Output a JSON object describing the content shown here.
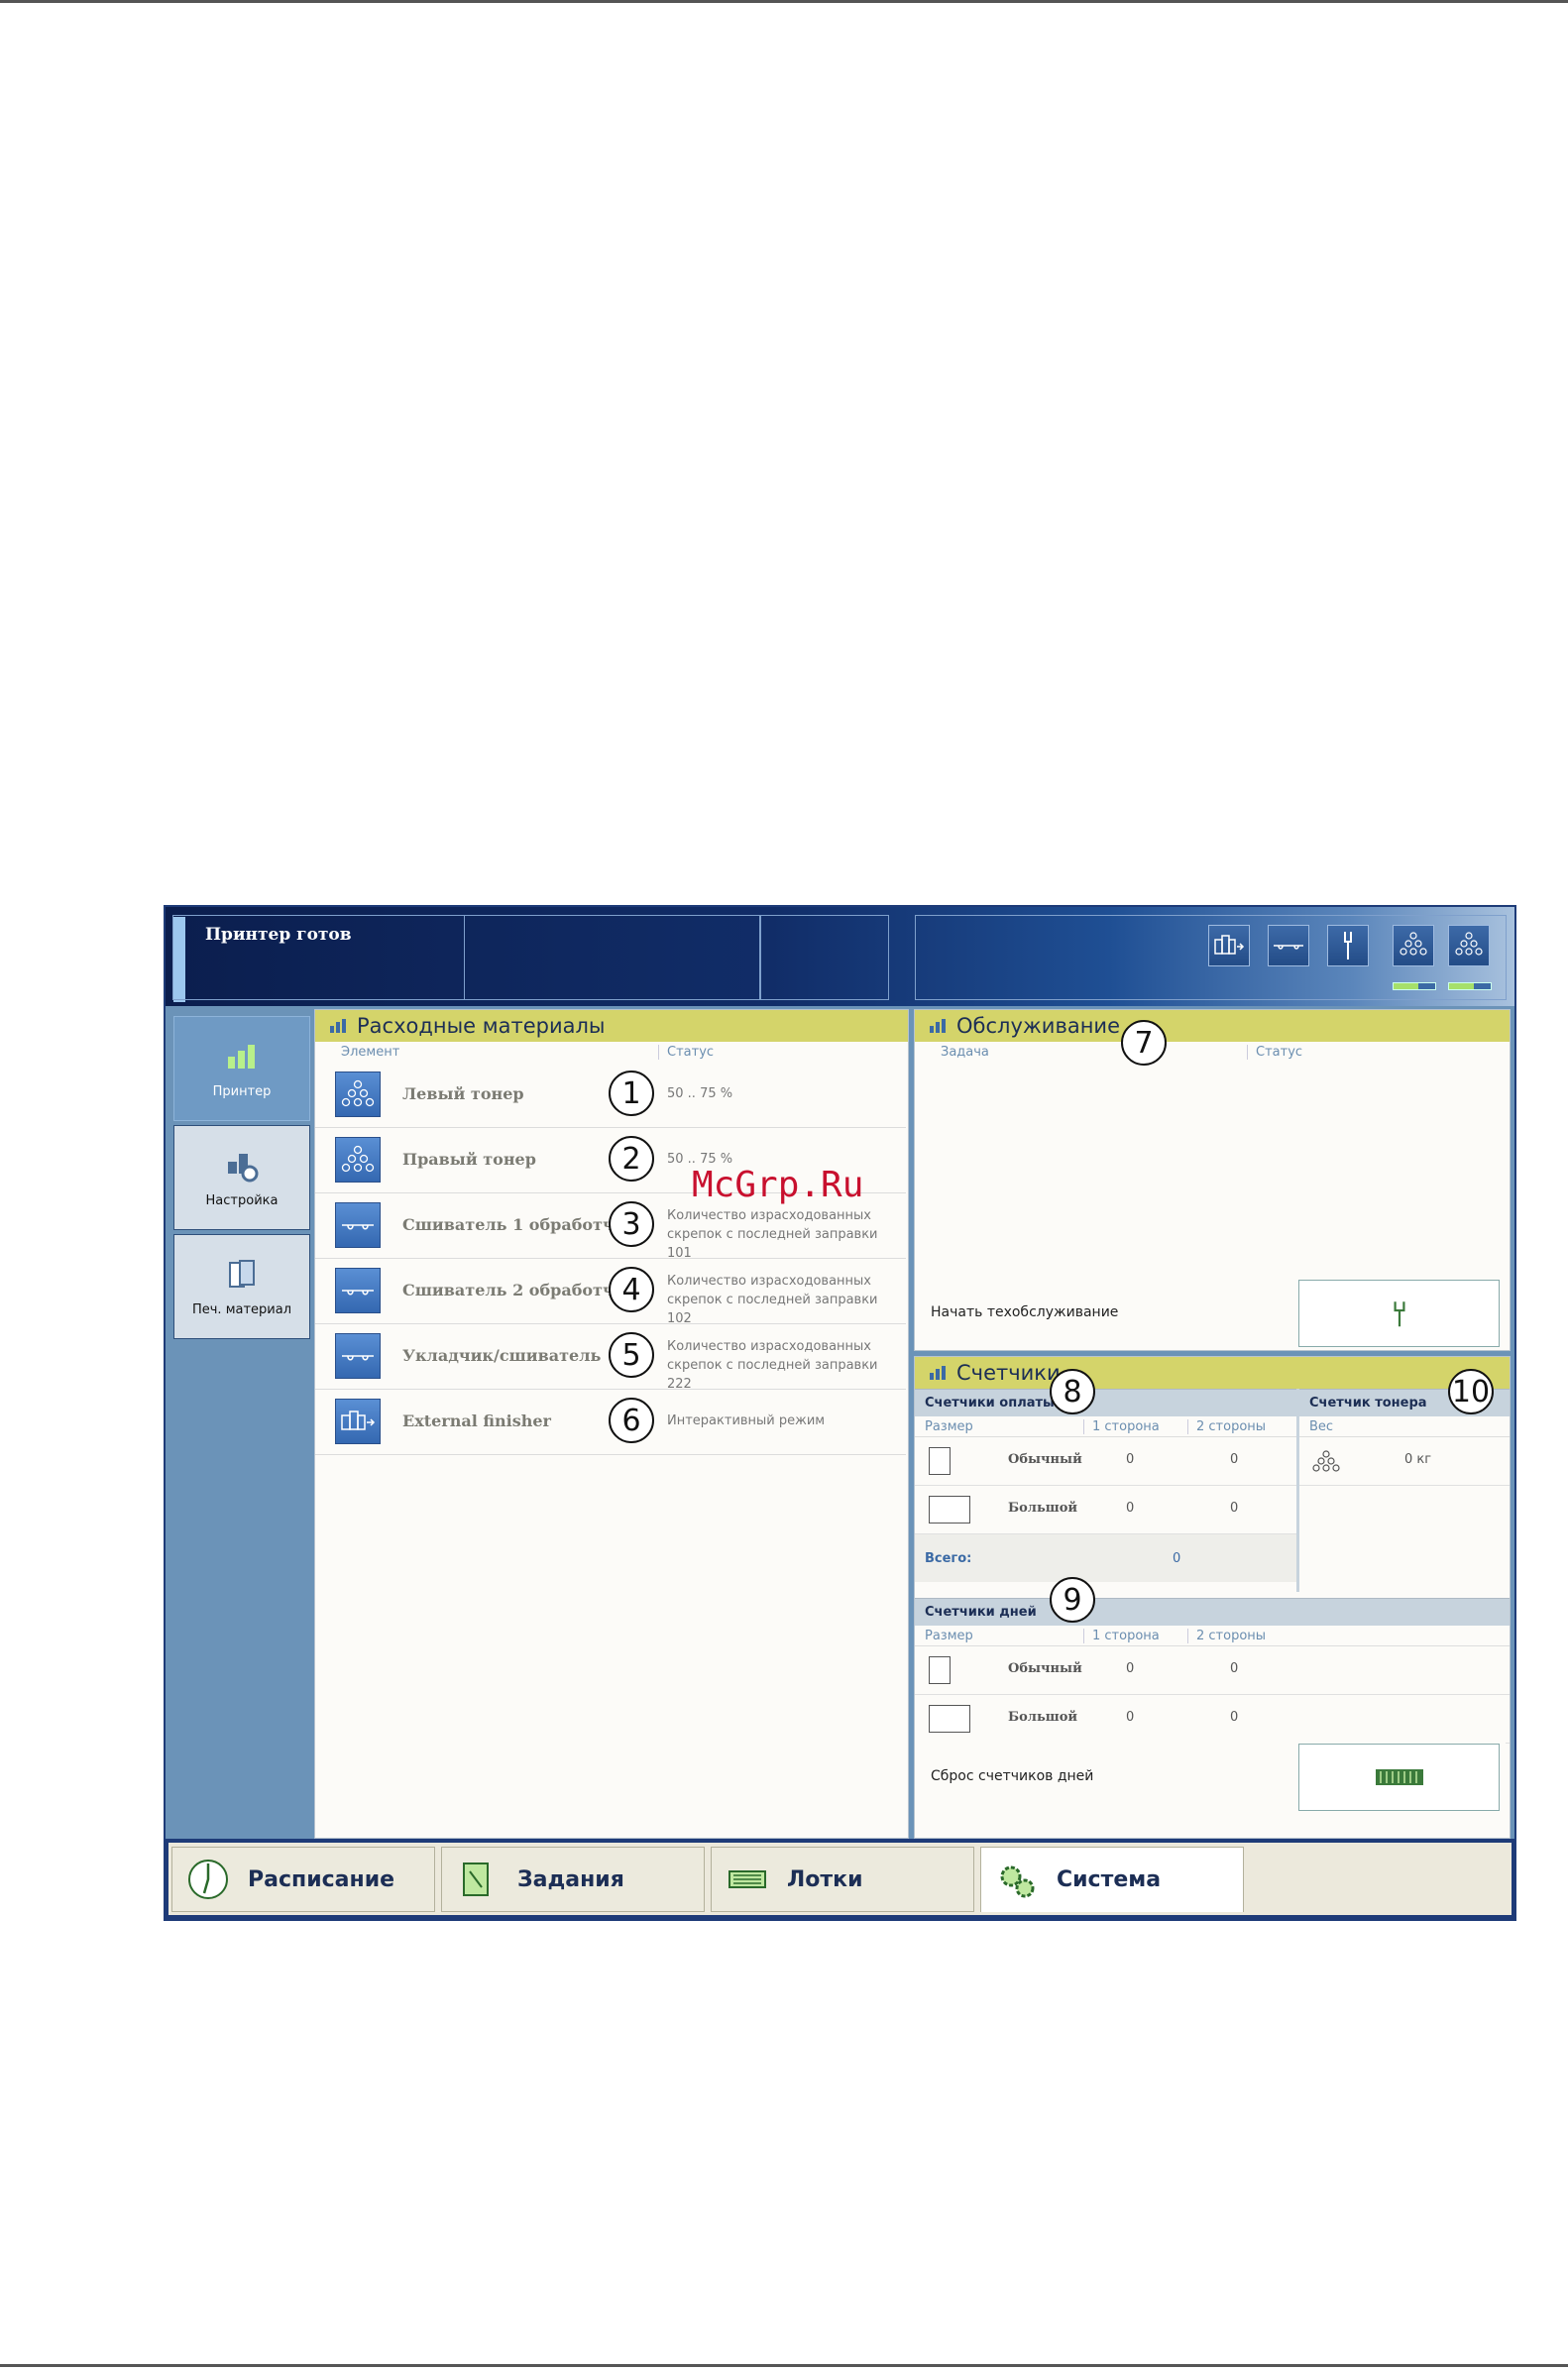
{
  "header": {
    "status": "Принтер готов"
  },
  "left_nav": [
    {
      "label": "Принтер",
      "icon": "printer-icon",
      "active": true
    },
    {
      "label": "Настройка",
      "icon": "settings-icon",
      "active": false
    },
    {
      "label": "Печ. материал",
      "icon": "media-icon",
      "active": false
    }
  ],
  "supplies": {
    "title": "Расходные материалы",
    "col_element": "Элемент",
    "col_status": "Статус",
    "rows": [
      {
        "callout": "1",
        "name": "Левый тонер",
        "status1": "50 .. 75 %",
        "status2": "",
        "icon": "toner-icon"
      },
      {
        "callout": "2",
        "name": "Правый тонер",
        "status1": "50 .. 75 %",
        "status2": "",
        "icon": "toner-icon"
      },
      {
        "callout": "3",
        "name": "Сшиватель 1 обработчика",
        "status1": "Количество израсходованных",
        "status2": "скрепок с последней заправки 101",
        "icon": "stapler-icon"
      },
      {
        "callout": "4",
        "name": "Сшиватель 2 обработчика",
        "status1": "Количество израсходованных",
        "status2": "скрепок с последней заправки 102",
        "icon": "stapler-icon"
      },
      {
        "callout": "5",
        "name": "Укладчик/сшиватель",
        "status1": "Количество израсходованных",
        "status2": "скрепок с последней заправки 222",
        "icon": "stapler-icon"
      },
      {
        "callout": "6",
        "name": "External finisher",
        "status1": "Интерактивный режим",
        "status2": "",
        "icon": "finisher-icon"
      }
    ]
  },
  "maintenance": {
    "title": "Обслуживание",
    "callout": "7",
    "col_task": "Задача",
    "col_status": "Статус",
    "action_label": "Начать техобслуживание"
  },
  "counters": {
    "title": "Счетчики",
    "billing": {
      "title": "Счетчики оплаты",
      "callout": "8",
      "col_size": "Размер",
      "col_1side": "1 сторона",
      "col_2side": "2 стороны",
      "rows": [
        {
          "label": "Обычный",
          "v1": "0",
          "v2": "0"
        },
        {
          "label": "Большой",
          "v1": "0",
          "v2": "0"
        }
      ],
      "total_label": "Всего:",
      "total_value": "0"
    },
    "toner": {
      "title": "Счетчик тонера",
      "callout": "10",
      "col_weight": "Вес",
      "value": "0 кг"
    },
    "days": {
      "title": "Счетчики дней",
      "callout": "9",
      "col_size": "Размер",
      "col_1side": "1 сторона",
      "col_2side": "2 стороны",
      "rows": [
        {
          "label": "Обычный",
          "v1": "0",
          "v2": "0"
        },
        {
          "label": "Большой",
          "v1": "0",
          "v2": "0"
        }
      ],
      "reset_label": "Сброс счетчиков дней"
    }
  },
  "tabs": [
    {
      "label": "Расписание",
      "icon": "clock-icon"
    },
    {
      "label": "Задания",
      "icon": "jobs-icon"
    },
    {
      "label": "Лотки",
      "icon": "trays-icon"
    },
    {
      "label": "Система",
      "icon": "gears-icon",
      "active": true
    }
  ],
  "watermark": "McGrp.Ru",
  "header_levels": [
    0.6,
    0.6
  ],
  "colors": {
    "section_title_bg": "#d4d46a",
    "header_dark": "#0b1e4e",
    "nav_bg": "#6b93b8",
    "level_fill": "#a6e06a"
  }
}
